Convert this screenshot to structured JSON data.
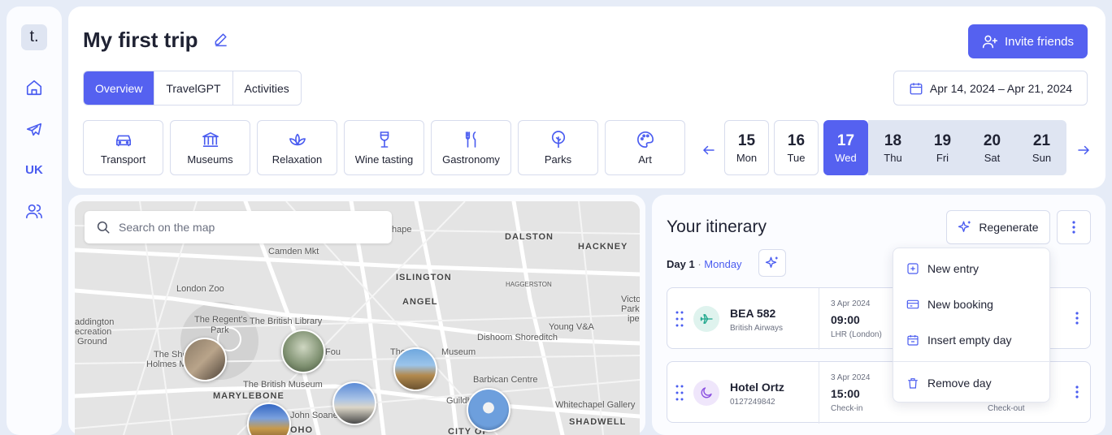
{
  "app": {
    "logo": "t."
  },
  "sidebar": {
    "items": [
      {
        "icon": "home-icon"
      },
      {
        "icon": "plane-icon"
      },
      {
        "label": "UK"
      },
      {
        "icon": "users-icon"
      }
    ]
  },
  "header": {
    "title": "My first trip",
    "invite_label": "Invite friends",
    "tabs": [
      "Overview",
      "TravelGPT",
      "Activities"
    ],
    "active_tab": "Overview",
    "date_range": "Apr 14, 2024 – Apr 21, 2024"
  },
  "categories": [
    {
      "label": "Transport",
      "icon": "car-icon"
    },
    {
      "label": "Museums",
      "icon": "museum-icon"
    },
    {
      "label": "Relaxation",
      "icon": "lotus-icon"
    },
    {
      "label": "Wine tasting",
      "icon": "wine-glass-icon"
    },
    {
      "label": "Gastronomy",
      "icon": "cutlery-icon"
    },
    {
      "label": "Parks",
      "icon": "tree-icon"
    },
    {
      "label": "Art",
      "icon": "palette-icon"
    }
  ],
  "days": [
    {
      "num": "15",
      "wd": "Mon"
    },
    {
      "num": "16",
      "wd": "Tue"
    },
    {
      "num": "17",
      "wd": "Wed"
    },
    {
      "num": "18",
      "wd": "Thu"
    },
    {
      "num": "19",
      "wd": "Fri"
    },
    {
      "num": "20",
      "wd": "Sat"
    },
    {
      "num": "21",
      "wd": "Sun"
    }
  ],
  "selected_day": "17",
  "map": {
    "search_placeholder": "Search on the map",
    "labels": [
      {
        "text": "Camden Mkt"
      },
      {
        "text": "DALSTON"
      },
      {
        "text": "HACKNEY"
      },
      {
        "text": "ISLINGTON"
      },
      {
        "text": "London Zoo"
      },
      {
        "text": "HAGGERSTON"
      },
      {
        "text": "ANGEL"
      },
      {
        "text": "The Regent's"
      },
      {
        "text": "Park"
      },
      {
        "text": "The British Library"
      },
      {
        "text": "Dishoom Shoreditch"
      },
      {
        "text": "Young V&A"
      },
      {
        "text": "Barbican Centre"
      },
      {
        "text": "The British Museum"
      },
      {
        "text": "MARYLEBONE"
      },
      {
        "text": "Guildhall"
      },
      {
        "text": "Whitechapel Gallery"
      },
      {
        "text": "SHADWELL"
      },
      {
        "text": "John Soane"
      },
      {
        "text": "CITY OF"
      },
      {
        "text": "addington"
      },
      {
        "text": "ecreation"
      },
      {
        "text": "Ground"
      },
      {
        "text": "The She"
      },
      {
        "text": "Holmes Mu"
      },
      {
        "text": "Fou"
      },
      {
        "text": "The"
      },
      {
        "text": "Museum"
      },
      {
        "text": "OHO"
      },
      {
        "text": "Victoria"
      },
      {
        "text": "Park"
      },
      {
        "text": "ipe"
      },
      {
        "text": "hape"
      }
    ]
  },
  "itinerary": {
    "title": "Your itinerary",
    "regenerate_label": "Regenerate",
    "day_label": "Day 1",
    "day_sep": "·",
    "weekday": "Monday",
    "entries": [
      {
        "name": "BEA 582",
        "sub": "British Airways",
        "date": "3 Apr 2024",
        "time": "09:00",
        "loc": "LHR (London)",
        "loc2": "",
        "icon": "plane-icon",
        "icon_color": "#1aa58a",
        "icon_bg": "#dff3ee"
      },
      {
        "name": "Hotel Ortz",
        "sub": "0127249842",
        "date": "3 Apr 2024",
        "time": "15:00",
        "loc": "Check-in",
        "loc2": "Check-out",
        "icon": "moon-icon",
        "icon_color": "#8a4fe0",
        "icon_bg": "#efe6fb"
      }
    ]
  },
  "menu": {
    "items": [
      {
        "label": "New entry",
        "icon": "plus-square-icon"
      },
      {
        "label": "New booking",
        "icon": "ticket-icon"
      },
      {
        "label": "Insert empty day",
        "icon": "calendar-icon"
      },
      {
        "label": "Remove day",
        "icon": "trash-icon"
      }
    ]
  },
  "colors": {
    "accent": "#5561f0",
    "accent_text": "#4a5cf0",
    "border": "#d7dced"
  }
}
